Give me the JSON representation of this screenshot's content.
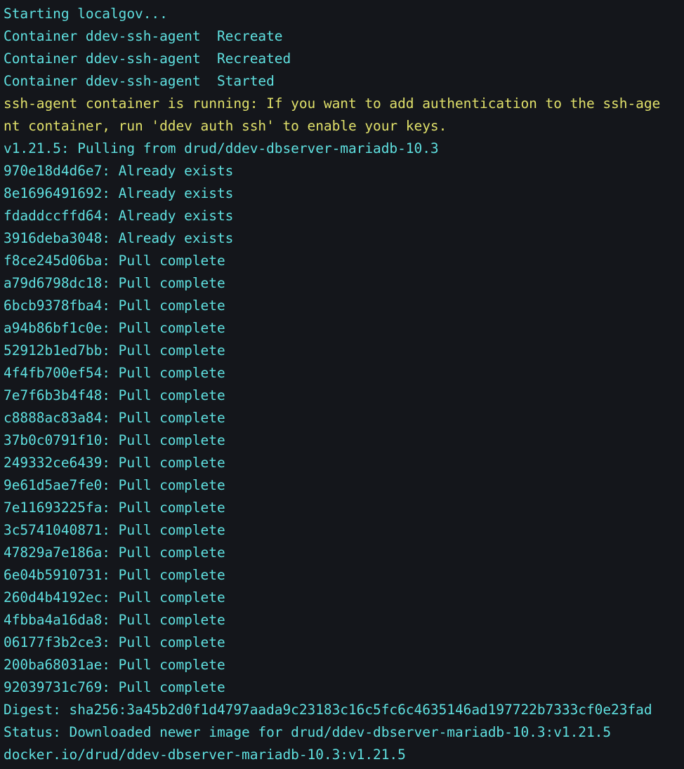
{
  "terminal": {
    "app": "terminal-output",
    "background_color": "#14161b",
    "colors": {
      "cyan": "#5fe0e0",
      "yellow": "#e0e06a",
      "white": "#d4d7dd"
    },
    "columns": 79,
    "lines": [
      {
        "color": "cyan",
        "text": "Starting localgov..."
      },
      {
        "color": "cyan",
        "text": "Container ddev-ssh-agent  Recreate"
      },
      {
        "color": "cyan",
        "text": "Container ddev-ssh-agent  Recreated"
      },
      {
        "color": "cyan",
        "text": "Container ddev-ssh-agent  Started"
      },
      {
        "color": "yellow",
        "text": "ssh-agent container is running: If you want to add authentication to the ssh-age"
      },
      {
        "color": "yellow",
        "text": "nt container, run 'ddev auth ssh' to enable your keys."
      },
      {
        "color": "cyan",
        "text": "v1.21.5: Pulling from drud/ddev-dbserver-mariadb-10.3"
      },
      {
        "color": "cyan",
        "text": "970e18d4d6e7: Already exists"
      },
      {
        "color": "cyan",
        "text": "8e1696491692: Already exists"
      },
      {
        "color": "cyan",
        "text": "fdaddccffd64: Already exists"
      },
      {
        "color": "cyan",
        "text": "3916deba3048: Already exists"
      },
      {
        "color": "cyan",
        "text": "f8ce245d06ba: Pull complete"
      },
      {
        "color": "cyan",
        "text": "a79d6798dc18: Pull complete"
      },
      {
        "color": "cyan",
        "text": "6bcb9378fba4: Pull complete"
      },
      {
        "color": "cyan",
        "text": "a94b86bf1c0e: Pull complete"
      },
      {
        "color": "cyan",
        "text": "52912b1ed7bb: Pull complete"
      },
      {
        "color": "cyan",
        "text": "4f4fb700ef54: Pull complete"
      },
      {
        "color": "cyan",
        "text": "7e7f6b3b4f48: Pull complete"
      },
      {
        "color": "cyan",
        "text": "c8888ac83a84: Pull complete"
      },
      {
        "color": "cyan",
        "text": "37b0c0791f10: Pull complete"
      },
      {
        "color": "cyan",
        "text": "249332ce6439: Pull complete"
      },
      {
        "color": "cyan",
        "text": "9e61d5ae7fe0: Pull complete"
      },
      {
        "color": "cyan",
        "text": "7e11693225fa: Pull complete"
      },
      {
        "color": "cyan",
        "text": "3c5741040871: Pull complete"
      },
      {
        "color": "cyan",
        "text": "47829a7e186a: Pull complete"
      },
      {
        "color": "cyan",
        "text": "6e04b5910731: Pull complete"
      },
      {
        "color": "cyan",
        "text": "260d4b4192ec: Pull complete"
      },
      {
        "color": "cyan",
        "text": "4fbba4a16da8: Pull complete"
      },
      {
        "color": "cyan",
        "text": "06177f3b2ce3: Pull complete"
      },
      {
        "color": "cyan",
        "text": "200ba68031ae: Pull complete"
      },
      {
        "color": "cyan",
        "text": "92039731c769: Pull complete"
      },
      {
        "color": "cyan",
        "text": "Digest: sha256:3a45b2d0f1d4797aada9c23183c16c5fc6c4635146ad197722b7333cf0e23fad"
      },
      {
        "color": "cyan",
        "text": "Status: Downloaded newer image for drud/ddev-dbserver-mariadb-10.3:v1.21.5"
      },
      {
        "color": "cyan",
        "text": "docker.io/drud/ddev-dbserver-mariadb-10.3:v1.21.5"
      }
    ]
  }
}
